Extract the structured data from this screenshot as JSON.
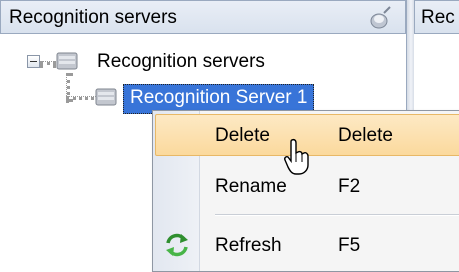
{
  "left_panel": {
    "title": "Recognition servers"
  },
  "right_panel": {
    "title": "Rec"
  },
  "tree": {
    "root": {
      "label": "Recognition servers",
      "expanded": true
    },
    "children": [
      {
        "label": "Recognition Server 1",
        "selected": true
      }
    ]
  },
  "context_menu": {
    "items": [
      {
        "label": "Delete",
        "shortcut": "Delete",
        "hovered": true
      },
      {
        "label": "Rename",
        "shortcut": "F2"
      },
      {
        "label": "Refresh",
        "shortcut": "F5",
        "icon": "refresh-icon"
      }
    ]
  },
  "colors": {
    "selection": "#3874d8",
    "menu_hover": "#fbd99d",
    "header": "#d9e2ee"
  }
}
